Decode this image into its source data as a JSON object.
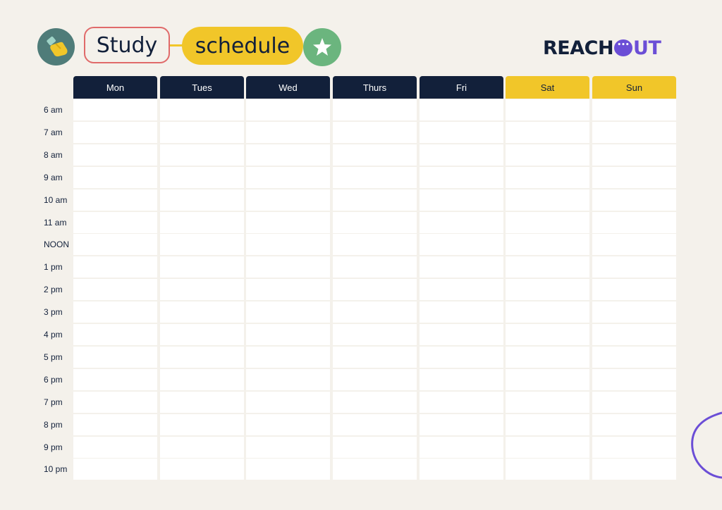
{
  "header": {
    "title_word1": "Study",
    "title_word2": "schedule",
    "hand_icon": "pointing-hand-icon",
    "star_icon": "star-icon"
  },
  "logo": {
    "part1": "REACH",
    "part2": "UT",
    "bubble_icon": "speech-bubble-icon"
  },
  "days": [
    {
      "label": "Mon",
      "weekend": false
    },
    {
      "label": "Tues",
      "weekend": false
    },
    {
      "label": "Wed",
      "weekend": false
    },
    {
      "label": "Thurs",
      "weekend": false
    },
    {
      "label": "Fri",
      "weekend": false
    },
    {
      "label": "Sat",
      "weekend": true
    },
    {
      "label": "Sun",
      "weekend": true
    }
  ],
  "times": [
    "6 am",
    "7 am",
    "8 am",
    "9 am",
    "10 am",
    "11 am",
    "NOON",
    "1 pm",
    "2 pm",
    "3 pm",
    "4 pm",
    "5 pm",
    "6 pm",
    "7 pm",
    "8 pm",
    "9 pm",
    "10 pm"
  ],
  "colors": {
    "background": "#f4f1eb",
    "navy": "#12203a",
    "yellow": "#f1c629",
    "teal": "#4f7c79",
    "green": "#6bb57e",
    "coral": "#e06a6a",
    "purple": "#6b4ed6"
  }
}
